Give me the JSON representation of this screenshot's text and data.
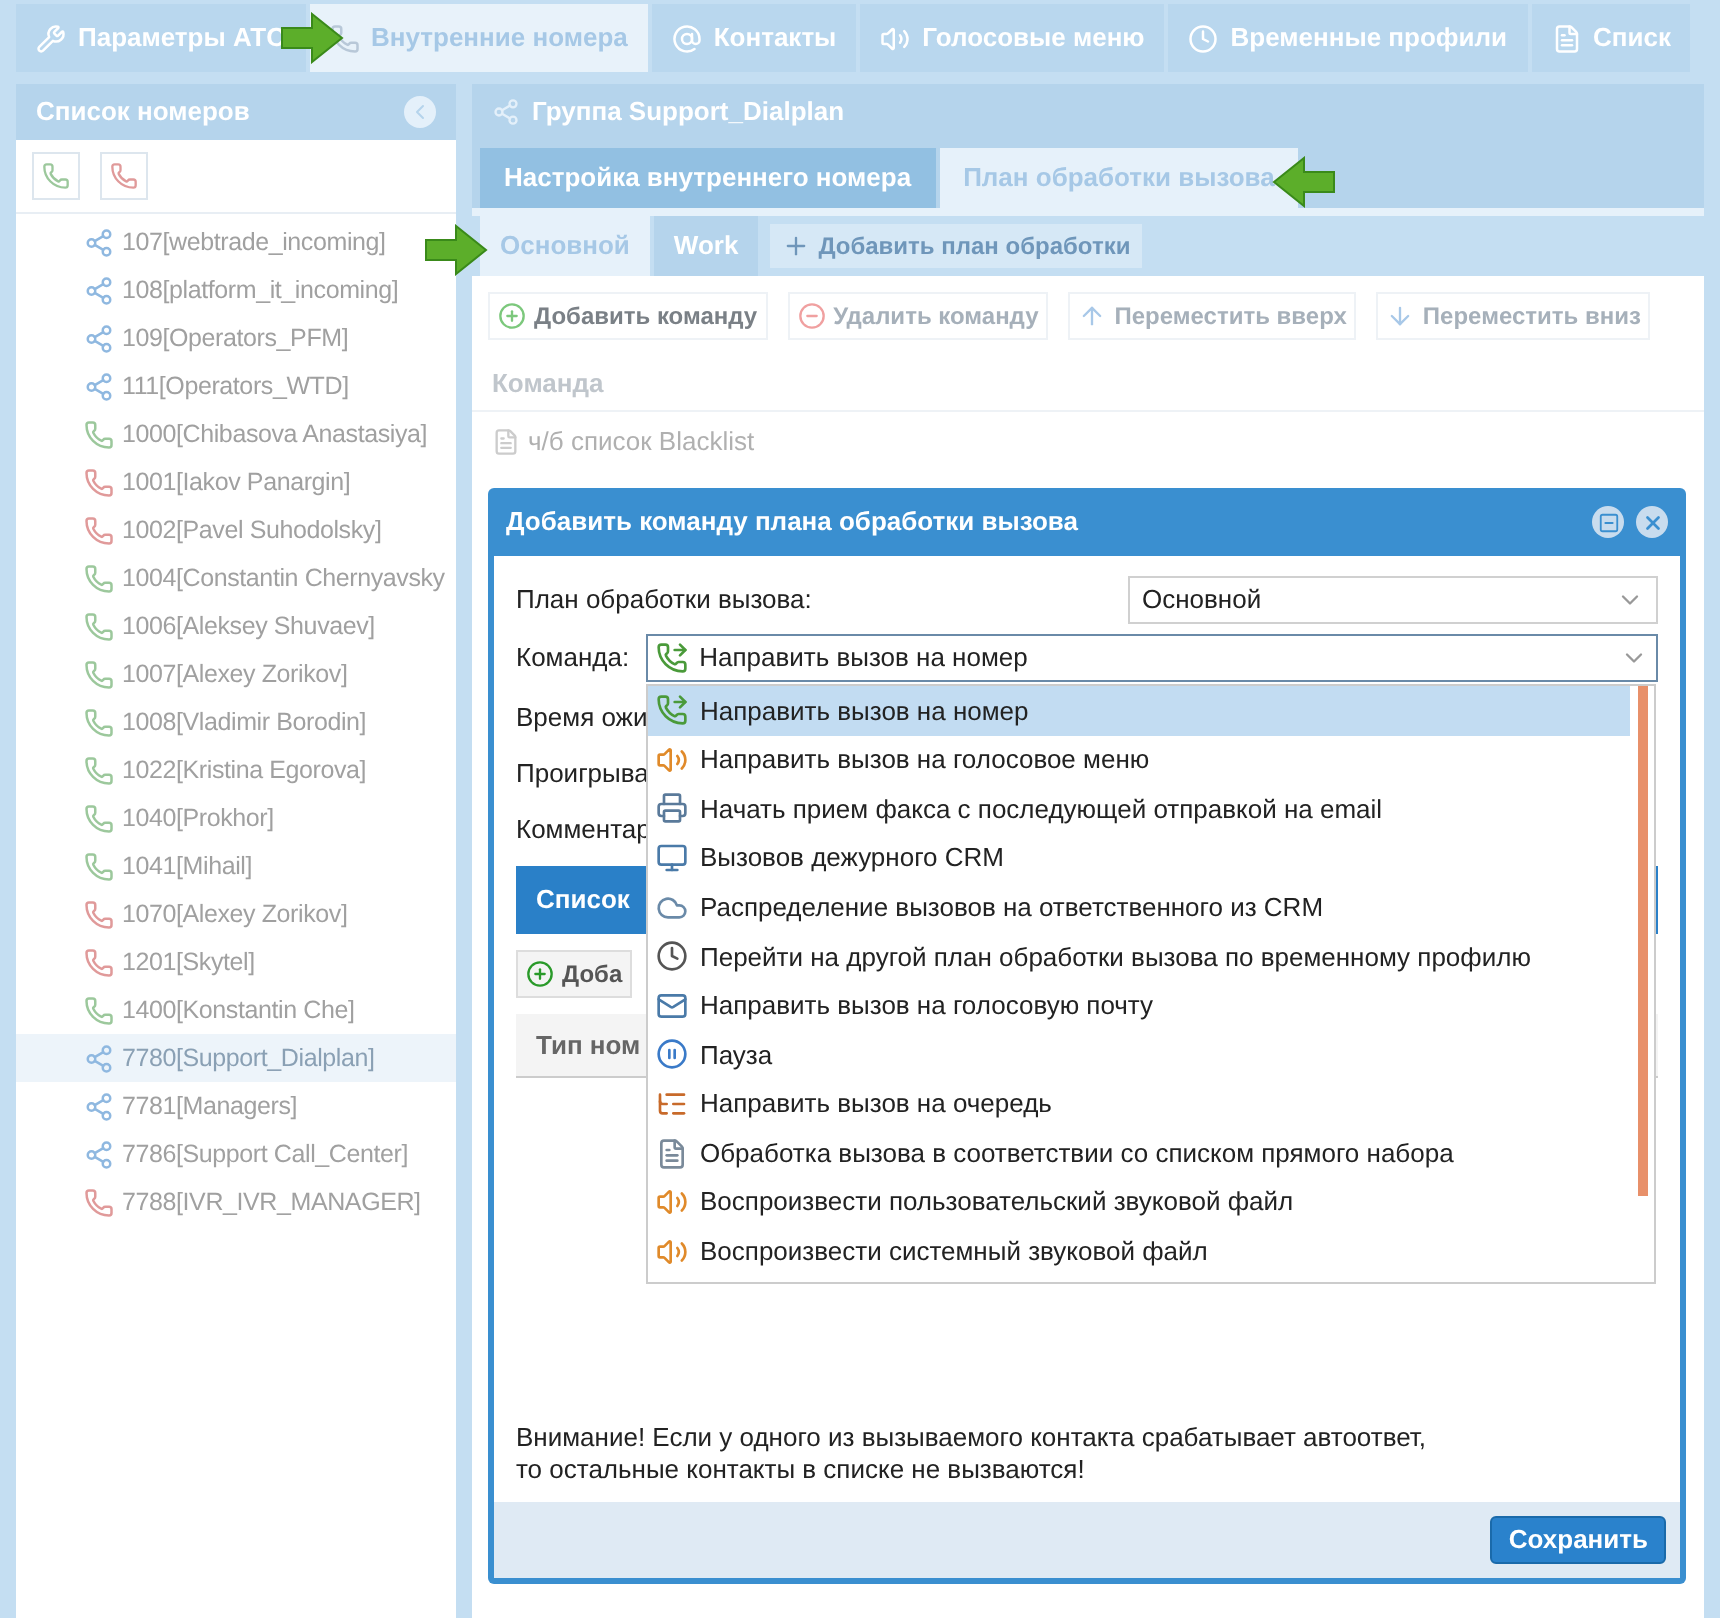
{
  "top_tabs": [
    {
      "label": "Параметры АТС",
      "kind": "settings",
      "selected": false
    },
    {
      "label": "Внутренние номера",
      "kind": "extensions",
      "selected": true
    },
    {
      "label": "Контакты",
      "kind": "contacts",
      "selected": false
    },
    {
      "label": "Голосовые меню",
      "kind": "ivr",
      "selected": false
    },
    {
      "label": "Временные профили",
      "kind": "schedule",
      "selected": false
    },
    {
      "label": "Списк",
      "kind": "lists",
      "selected": false
    }
  ],
  "sidebar": {
    "title": "Список номеров",
    "items": [
      {
        "label": "107[webtrade_incoming]",
        "kind": "group",
        "selected": false
      },
      {
        "label": "108[platform_it_incoming]",
        "kind": "group",
        "selected": false
      },
      {
        "label": "109[Operators_PFM]",
        "kind": "group",
        "selected": false
      },
      {
        "label": "111[Operators_WTD]",
        "kind": "group",
        "selected": false
      },
      {
        "label": "1000[Chibasova Anastasiya]",
        "kind": "phone_online",
        "selected": false
      },
      {
        "label": "1001[Iakov Panargin]",
        "kind": "phone_offline",
        "selected": false
      },
      {
        "label": "1002[Pavel Suhodolsky]",
        "kind": "phone_offline",
        "selected": false
      },
      {
        "label": "1004[Constantin Chernyavsky",
        "kind": "phone_online",
        "selected": false
      },
      {
        "label": "1006[Aleksey Shuvaev]",
        "kind": "phone_online",
        "selected": false
      },
      {
        "label": "1007[Alexey Zorikov]",
        "kind": "phone_online",
        "selected": false
      },
      {
        "label": "1008[Vladimir Borodin]",
        "kind": "phone_online",
        "selected": false
      },
      {
        "label": "1022[Kristina Egorova]",
        "kind": "phone_online",
        "selected": false
      },
      {
        "label": "1040[Prokhor]",
        "kind": "phone_online",
        "selected": false
      },
      {
        "label": "1041[Mihail]",
        "kind": "phone_online",
        "selected": false
      },
      {
        "label": "1070[Alexey Zorikov]",
        "kind": "phone_offline",
        "selected": false
      },
      {
        "label": "1201[Skytel]",
        "kind": "phone_offline",
        "selected": false
      },
      {
        "label": "1400[Konstantin Che]",
        "kind": "phone_online",
        "selected": false
      },
      {
        "label": "7780[Support_Dialplan]",
        "kind": "group",
        "selected": true
      },
      {
        "label": "7781[Managers]",
        "kind": "group",
        "selected": false
      },
      {
        "label": "7786[Support Call_Center]",
        "kind": "group",
        "selected": false
      },
      {
        "label": "7788[IVR_IVR_MANAGER]",
        "kind": "phone_offline",
        "selected": false
      }
    ]
  },
  "group": {
    "title": "Группа Support_Dialplan",
    "tabs": [
      {
        "label": "Настройка внутреннего номера",
        "selected": false
      },
      {
        "label": "План обработки вызова",
        "selected": true
      }
    ],
    "plan_tabs": [
      {
        "label": "Основной",
        "selected": true
      },
      {
        "label": "Work",
        "selected": false
      }
    ],
    "add_plan_button": "Добавить план обработки",
    "toolbar": [
      {
        "label": "Добавить команду",
        "kind": "add",
        "disabled": false
      },
      {
        "label": "Удалить команду",
        "kind": "delete",
        "disabled": true
      },
      {
        "label": "Переместить вверх",
        "kind": "up",
        "disabled": true
      },
      {
        "label": "Переместить вниз",
        "kind": "down",
        "disabled": true
      }
    ],
    "table": {
      "columns": [
        "Команда"
      ],
      "rows": [
        {
          "command": "ч/б список Blacklist"
        }
      ]
    }
  },
  "dialog": {
    "title": "Добавить команду плана обработки вызова",
    "plan_field": {
      "label": "План обработки вызова:",
      "value": "Основной"
    },
    "command_field": {
      "label": "Команда:",
      "value": "Направить вызов на номер",
      "kind": "transfer"
    },
    "covered_labels": [
      "Время ожи",
      "Проигрыва",
      "Комментар"
    ],
    "contacts_section": {
      "title": "Список",
      "add_button": "Доба",
      "column": "Тип ном"
    },
    "dropdown": {
      "options": [
        {
          "label": "Направить вызов на номер",
          "kind": "transfer",
          "selected": true
        },
        {
          "label": "Направить вызов на голосовое меню",
          "kind": "ivr",
          "selected": false
        },
        {
          "label": "Начать прием факса с последующей отправкой на email",
          "kind": "fax",
          "selected": false
        },
        {
          "label": "Вызовов дежурного CRM",
          "kind": "crm",
          "selected": false
        },
        {
          "label": "Распределение вызовов на ответственного из CRM",
          "kind": "crm_cloud",
          "selected": false
        },
        {
          "label": "Перейти на другой план обработки вызова по временному профилю",
          "kind": "schedule",
          "selected": false
        },
        {
          "label": "Направить вызов на голосовую почту",
          "kind": "voicemail",
          "selected": false
        },
        {
          "label": "Пауза",
          "kind": "pause",
          "selected": false
        },
        {
          "label": "Направить вызов на очередь",
          "kind": "queue",
          "selected": false
        },
        {
          "label": "Обработка вызова в соответствии со списком прямого набора",
          "kind": "list",
          "selected": false
        },
        {
          "label": "Воспроизвести пользовательский звуковой файл",
          "kind": "sound",
          "selected": false
        },
        {
          "label": "Воспроизвести системный звуковой файл",
          "kind": "sound",
          "selected": false
        }
      ]
    },
    "warning": "Внимание! Если у одного из вызываемого контакта срабатывает автоответ,\nто остальные контакты в списке не вызваются!",
    "save_button": "Сохранить"
  }
}
